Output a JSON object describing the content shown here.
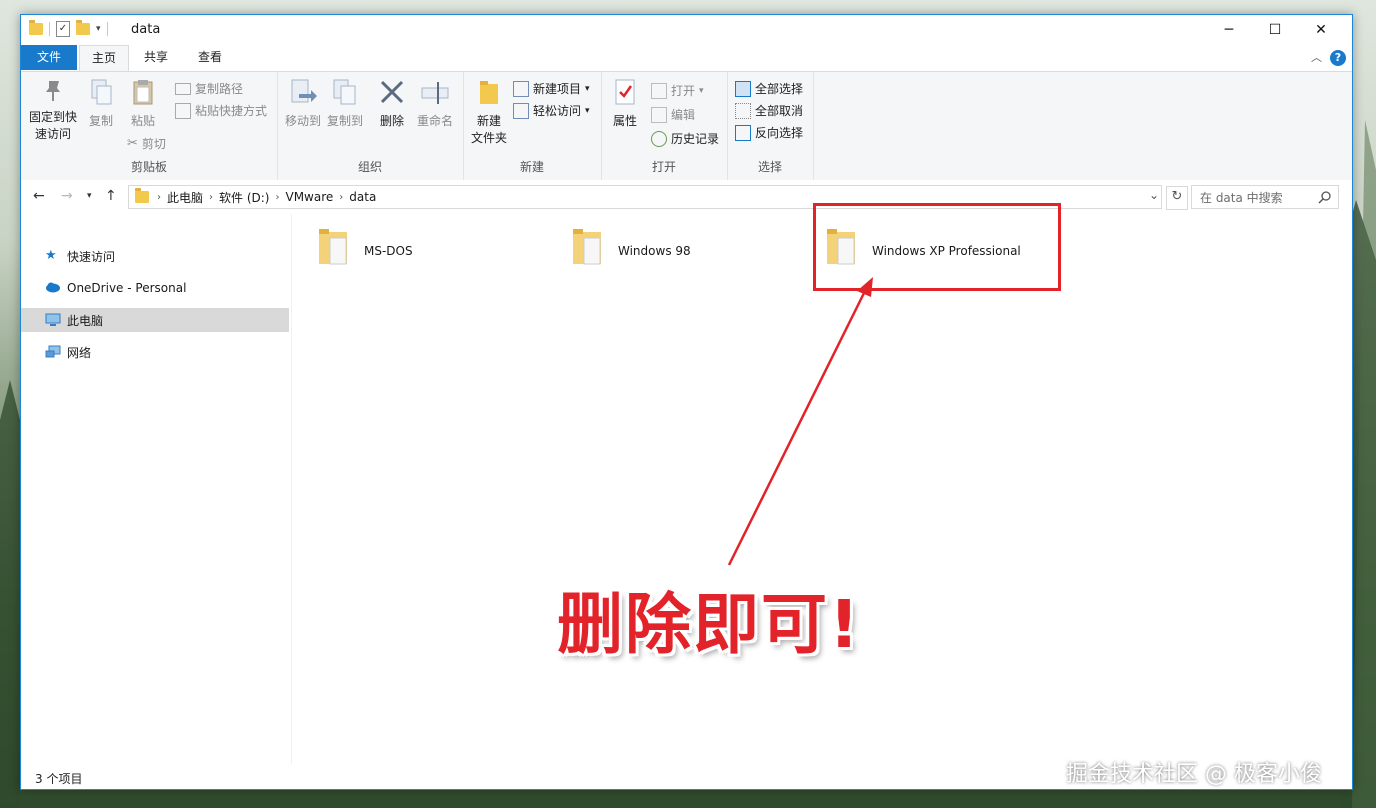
{
  "window": {
    "title": "data",
    "controls": {
      "minimize": "─",
      "maximize": "☐",
      "close": "✕"
    }
  },
  "ribbon_tabs": [
    "文件",
    "主页",
    "共享",
    "查看"
  ],
  "ribbon": {
    "clipboard": {
      "pin": "固定到快\n速访问",
      "pin_line1": "固定到快",
      "pin_line2": "速访问",
      "copy": "复制",
      "paste": "粘贴",
      "copy_path": "复制路径",
      "paste_shortcut": "粘贴快捷方式",
      "cut": "剪切",
      "label": "剪贴板"
    },
    "organize": {
      "move_to": "移动到",
      "copy_to": "复制到",
      "delete": "删除",
      "rename": "重命名",
      "label": "组织"
    },
    "new": {
      "new_folder_line1": "新建",
      "new_folder_line2": "文件夹",
      "new_item": "新建项目",
      "easy_access": "轻松访问",
      "label": "新建"
    },
    "open": {
      "properties": "属性",
      "open": "打开",
      "edit": "编辑",
      "history": "历史记录",
      "label": "打开"
    },
    "select": {
      "select_all": "全部选择",
      "select_none": "全部取消",
      "invert": "反向选择",
      "label": "选择"
    }
  },
  "address": {
    "breadcrumbs": [
      "此电脑",
      "软件 (D:)",
      "VMware",
      "data"
    ],
    "search_placeholder": "在 data 中搜索"
  },
  "nav_pane": [
    {
      "label": "快速访问",
      "icon": "star-icon"
    },
    {
      "label": "OneDrive - Personal",
      "icon": "cloud-icon"
    },
    {
      "label": "此电脑",
      "icon": "computer-icon",
      "selected": true
    },
    {
      "label": "网络",
      "icon": "network-icon"
    }
  ],
  "files": [
    {
      "name": "MS-DOS"
    },
    {
      "name": "Windows 98"
    },
    {
      "name": "Windows XP Professional"
    }
  ],
  "status": {
    "item_count": "3 个项目"
  },
  "annotation": {
    "text": "删除即可!"
  },
  "watermark": "掘金技术社区 @ 极客小俊",
  "colors": {
    "accent": "#1979ca",
    "annotation_red": "#e2232a",
    "folder": "#f3c94d"
  }
}
